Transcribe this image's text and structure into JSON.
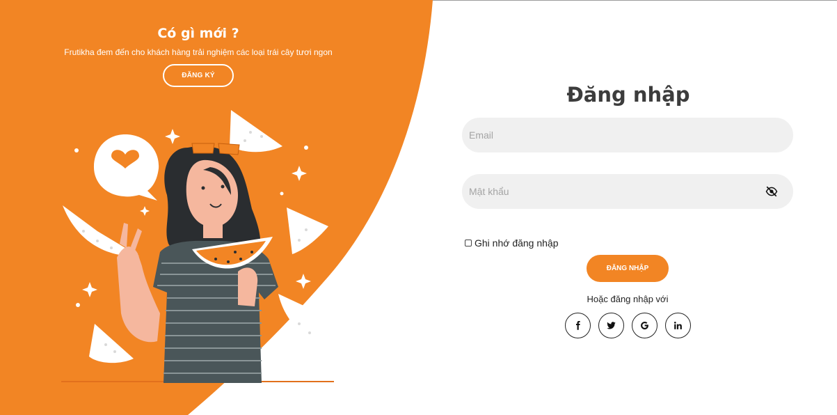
{
  "promo": {
    "title": "Có gì mới ?",
    "text": "Frutikha đem đến cho khách hàng trải nghiệm các loại trái cây tươi ngon",
    "register_label": "ĐĂNG KÝ"
  },
  "illustration": {
    "icon": "woman-eating-watermelon-illustration"
  },
  "login": {
    "title": "Đăng nhập",
    "email_placeholder": "Email",
    "password_placeholder": "Mật khẩu",
    "password_toggle_icon": "eye-off-icon",
    "remember_label": "Ghi nhớ đăng nhập",
    "remember_checked": false,
    "submit_label": "ĐĂNG NHẬP",
    "alt_text": "Hoặc đăng nhập với",
    "socials": [
      "facebook-icon",
      "twitter-icon",
      "google-icon",
      "linkedin-icon"
    ]
  },
  "colors": {
    "accent": "#f28524",
    "field_bg": "#f0f0f0"
  }
}
